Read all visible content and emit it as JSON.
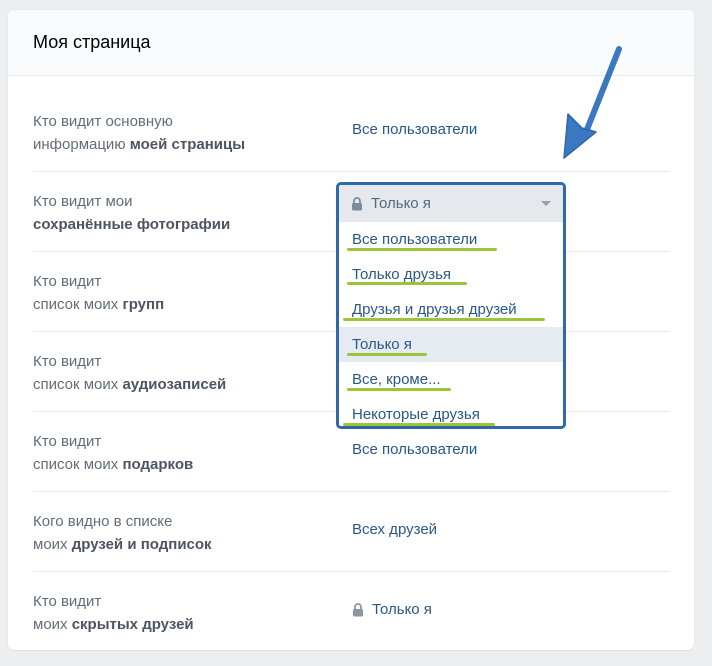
{
  "page": {
    "title": "Моя страница"
  },
  "rows": [
    {
      "label_plain1": "Кто видит основную",
      "label_plain2": "информацию ",
      "label_bold": "моей страницы",
      "value": "Все пользователи",
      "locked": false
    },
    {
      "label_plain1": "Кто видит мои",
      "label_plain2": "",
      "label_bold": "сохранённые фотографии",
      "value": "Только я",
      "locked": true
    },
    {
      "label_plain1": "Кто видит",
      "label_plain2": "список моих ",
      "label_bold": "групп",
      "value": "",
      "locked": false
    },
    {
      "label_plain1": "Кто видит",
      "label_plain2": "список моих ",
      "label_bold": "аудиозаписей",
      "value": "",
      "locked": false
    },
    {
      "label_plain1": "Кто видит",
      "label_plain2": "список моих ",
      "label_bold": "подарков",
      "value": "Все пользователи",
      "locked": false
    },
    {
      "label_plain1": "Кого видно в списке",
      "label_plain2": "моих ",
      "label_bold": "друзей и подписок",
      "value": "Всех друзей",
      "locked": false
    },
    {
      "label_plain1": "Кто видит",
      "label_plain2": "моих ",
      "label_bold": "скрытых друзей",
      "value": "Только я",
      "locked": true
    }
  ],
  "dropdown": {
    "selected_label": "Только я",
    "icon": "lock-icon",
    "options": [
      "Все пользователи",
      "Только друзья",
      "Друзья и друзья друзей",
      "Только я",
      "Все, кроме...",
      "Некоторые друзья"
    ],
    "selected_index": 3
  },
  "colors": {
    "link": "#2a5885",
    "highlight_border": "#2f69a8",
    "annotation_underline": "#9ac53a",
    "annotation_arrow": "#3a78c2"
  }
}
